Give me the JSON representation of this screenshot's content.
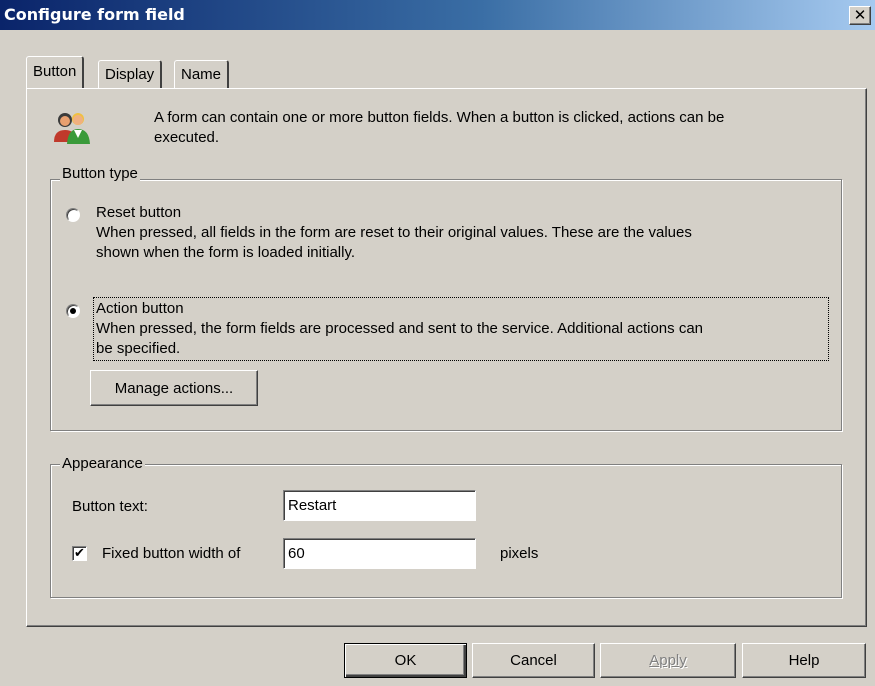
{
  "window": {
    "title": "Configure form field",
    "close_symbol": "✕"
  },
  "tabs": [
    {
      "label": "Button",
      "active": true
    },
    {
      "label": "Display",
      "active": false
    },
    {
      "label": "Name",
      "active": false
    }
  ],
  "info": {
    "icon": "users-icon",
    "line1": "A form can contain one or more button fields. When a button is clicked, actions can be",
    "line2": "executed."
  },
  "button_type": {
    "legend": "Button type",
    "options": [
      {
        "label": "Reset button",
        "selected": false,
        "desc1": "When pressed, all fields in the form are reset to their original values. These are the values",
        "desc2": "shown when the form is loaded initially."
      },
      {
        "label": "Action button",
        "selected": true,
        "desc1": "When pressed, the form fields are processed and sent to the service. Additional actions can",
        "desc2": "be specified."
      }
    ],
    "manage_label": "Manage actions..."
  },
  "appearance": {
    "legend": "Appearance",
    "button_text_label": "Button text:",
    "button_text_value": "Restart",
    "fixed_width_checked": true,
    "fixed_width_label": "Fixed button width of",
    "fixed_width_value": "60",
    "unit": "pixels"
  },
  "footer": {
    "ok": "OK",
    "cancel": "Cancel",
    "apply": "Apply",
    "help": "Help"
  },
  "colors": {
    "face": "#d4d0c8",
    "title_start": "#0a246a",
    "title_end": "#a6caf0"
  }
}
